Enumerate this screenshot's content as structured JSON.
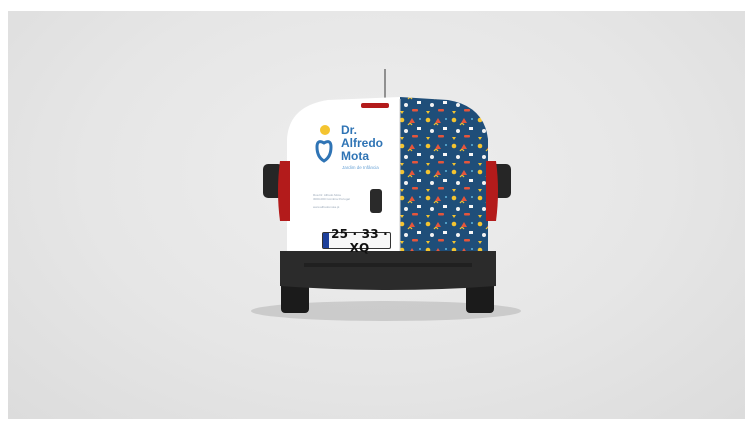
{
  "van": {
    "logo_lines": [
      "Dr.",
      "Alfredo",
      "Mota"
    ],
    "tagline": "Jardim de Infância",
    "info_lines": [
      "Rua Dr. Alfredo Mota",
      "3000-000 Coimbra Portugal",
      "",
      "www.alfredomota.pt"
    ],
    "plate": "25 · 33 · XQ"
  },
  "colors": {
    "background": "#e8e8e8",
    "van_body": "#ffffff",
    "pattern_bg": "#1f4e79",
    "brand_blue": "#2f74b5",
    "brand_yellow": "#f4c430",
    "tail_light": "#b31b1b",
    "bumper": "#2b2b2b"
  }
}
